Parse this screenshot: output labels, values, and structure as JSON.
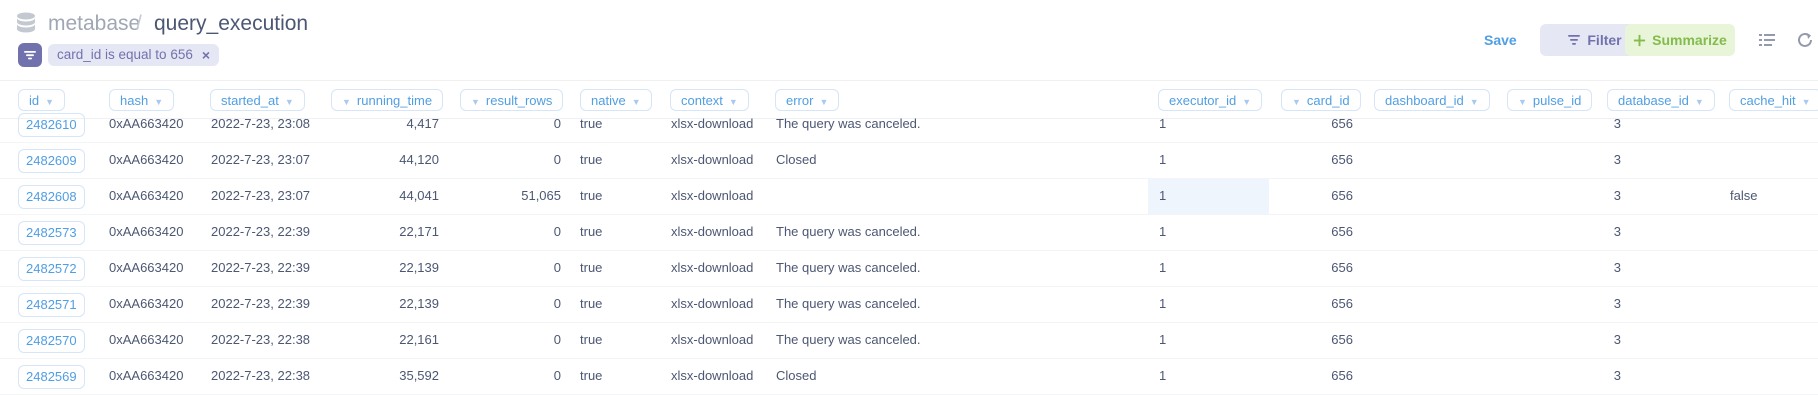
{
  "header": {
    "database": "metabase",
    "separator": "/",
    "table": "query_execution",
    "filter_pill": "card_id is equal to 656",
    "filter_remove": "×",
    "save_label": "Save",
    "filter_label": "Filter",
    "summarize_label": "Summarize"
  },
  "colors": {
    "brand": "#509ee3",
    "filter": "#7172ad",
    "summarize": "#84bb4c",
    "text": "#4c5773"
  },
  "table": {
    "columns": [
      {
        "label": "id"
      },
      {
        "label": "hash"
      },
      {
        "label": "started_at"
      },
      {
        "label": "running_time"
      },
      {
        "label": "result_rows"
      },
      {
        "label": "native"
      },
      {
        "label": "context"
      },
      {
        "label": "error"
      },
      {
        "label": "executor_id"
      },
      {
        "label": "card_id"
      },
      {
        "label": "dashboard_id"
      },
      {
        "label": "pulse_id"
      },
      {
        "label": "database_id"
      },
      {
        "label": "cache_hit"
      }
    ],
    "rows": [
      {
        "id": "2482610",
        "hash": "0xAA663420",
        "started_at": "2022-7-23, 23:08",
        "running_time": "4,417",
        "result_rows": "0",
        "native": "true",
        "context": "xlsx-download",
        "error": "The query was canceled.",
        "executor_id": "1",
        "card_id": "656",
        "dashboard_id": "",
        "pulse_id": "",
        "database_id": "3",
        "cache_hit": ""
      },
      {
        "id": "2482609",
        "hash": "0xAA663420",
        "started_at": "2022-7-23, 23:07",
        "running_time": "44,120",
        "result_rows": "0",
        "native": "true",
        "context": "xlsx-download",
        "error": "Closed",
        "executor_id": "1",
        "card_id": "656",
        "dashboard_id": "",
        "pulse_id": "",
        "database_id": "3",
        "cache_hit": ""
      },
      {
        "id": "2482608",
        "hash": "0xAA663420",
        "started_at": "2022-7-23, 23:07",
        "running_time": "44,041",
        "result_rows": "51,065",
        "native": "true",
        "context": "xlsx-download",
        "error": "",
        "executor_id": "1",
        "card_id": "656",
        "dashboard_id": "",
        "pulse_id": "",
        "database_id": "3",
        "cache_hit": "false"
      },
      {
        "id": "2482573",
        "hash": "0xAA663420",
        "started_at": "2022-7-23, 22:39",
        "running_time": "22,171",
        "result_rows": "0",
        "native": "true",
        "context": "xlsx-download",
        "error": "The query was canceled.",
        "executor_id": "1",
        "card_id": "656",
        "dashboard_id": "",
        "pulse_id": "",
        "database_id": "3",
        "cache_hit": ""
      },
      {
        "id": "2482572",
        "hash": "0xAA663420",
        "started_at": "2022-7-23, 22:39",
        "running_time": "22,139",
        "result_rows": "0",
        "native": "true",
        "context": "xlsx-download",
        "error": "The query was canceled.",
        "executor_id": "1",
        "card_id": "656",
        "dashboard_id": "",
        "pulse_id": "",
        "database_id": "3",
        "cache_hit": ""
      },
      {
        "id": "2482571",
        "hash": "0xAA663420",
        "started_at": "2022-7-23, 22:39",
        "running_time": "22,139",
        "result_rows": "0",
        "native": "true",
        "context": "xlsx-download",
        "error": "The query was canceled.",
        "executor_id": "1",
        "card_id": "656",
        "dashboard_id": "",
        "pulse_id": "",
        "database_id": "3",
        "cache_hit": ""
      },
      {
        "id": "2482570",
        "hash": "0xAA663420",
        "started_at": "2022-7-23, 22:38",
        "running_time": "22,161",
        "result_rows": "0",
        "native": "true",
        "context": "xlsx-download",
        "error": "The query was canceled.",
        "executor_id": "1",
        "card_id": "656",
        "dashboard_id": "",
        "pulse_id": "",
        "database_id": "3",
        "cache_hit": ""
      },
      {
        "id": "2482569",
        "hash": "0xAA663420",
        "started_at": "2022-7-23, 22:38",
        "running_time": "35,592",
        "result_rows": "0",
        "native": "true",
        "context": "xlsx-download",
        "error": "Closed",
        "executor_id": "1",
        "card_id": "656",
        "dashboard_id": "",
        "pulse_id": "",
        "database_id": "3",
        "cache_hit": ""
      }
    ]
  }
}
